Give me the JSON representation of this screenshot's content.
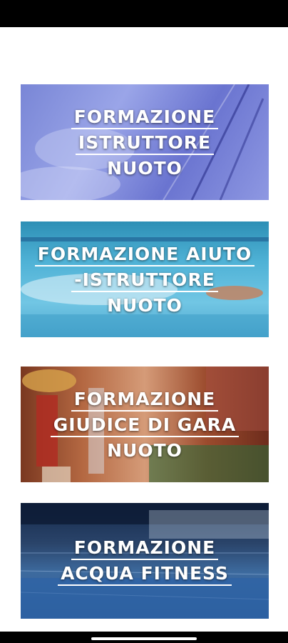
{
  "cards": [
    {
      "lines": [
        "FORMAZIONE",
        "ISTRUTTORE",
        "NUOTO"
      ]
    },
    {
      "lines": [
        "FORMAZIONE AIUTO",
        "-ISTRUTTORE",
        "NUOTO"
      ]
    },
    {
      "lines": [
        "FORMAZIONE",
        "GIUDICE DI GARA",
        "NUOTO"
      ]
    },
    {
      "lines": [
        "FORMAZIONE",
        "ACQUA FITNESS"
      ]
    }
  ]
}
